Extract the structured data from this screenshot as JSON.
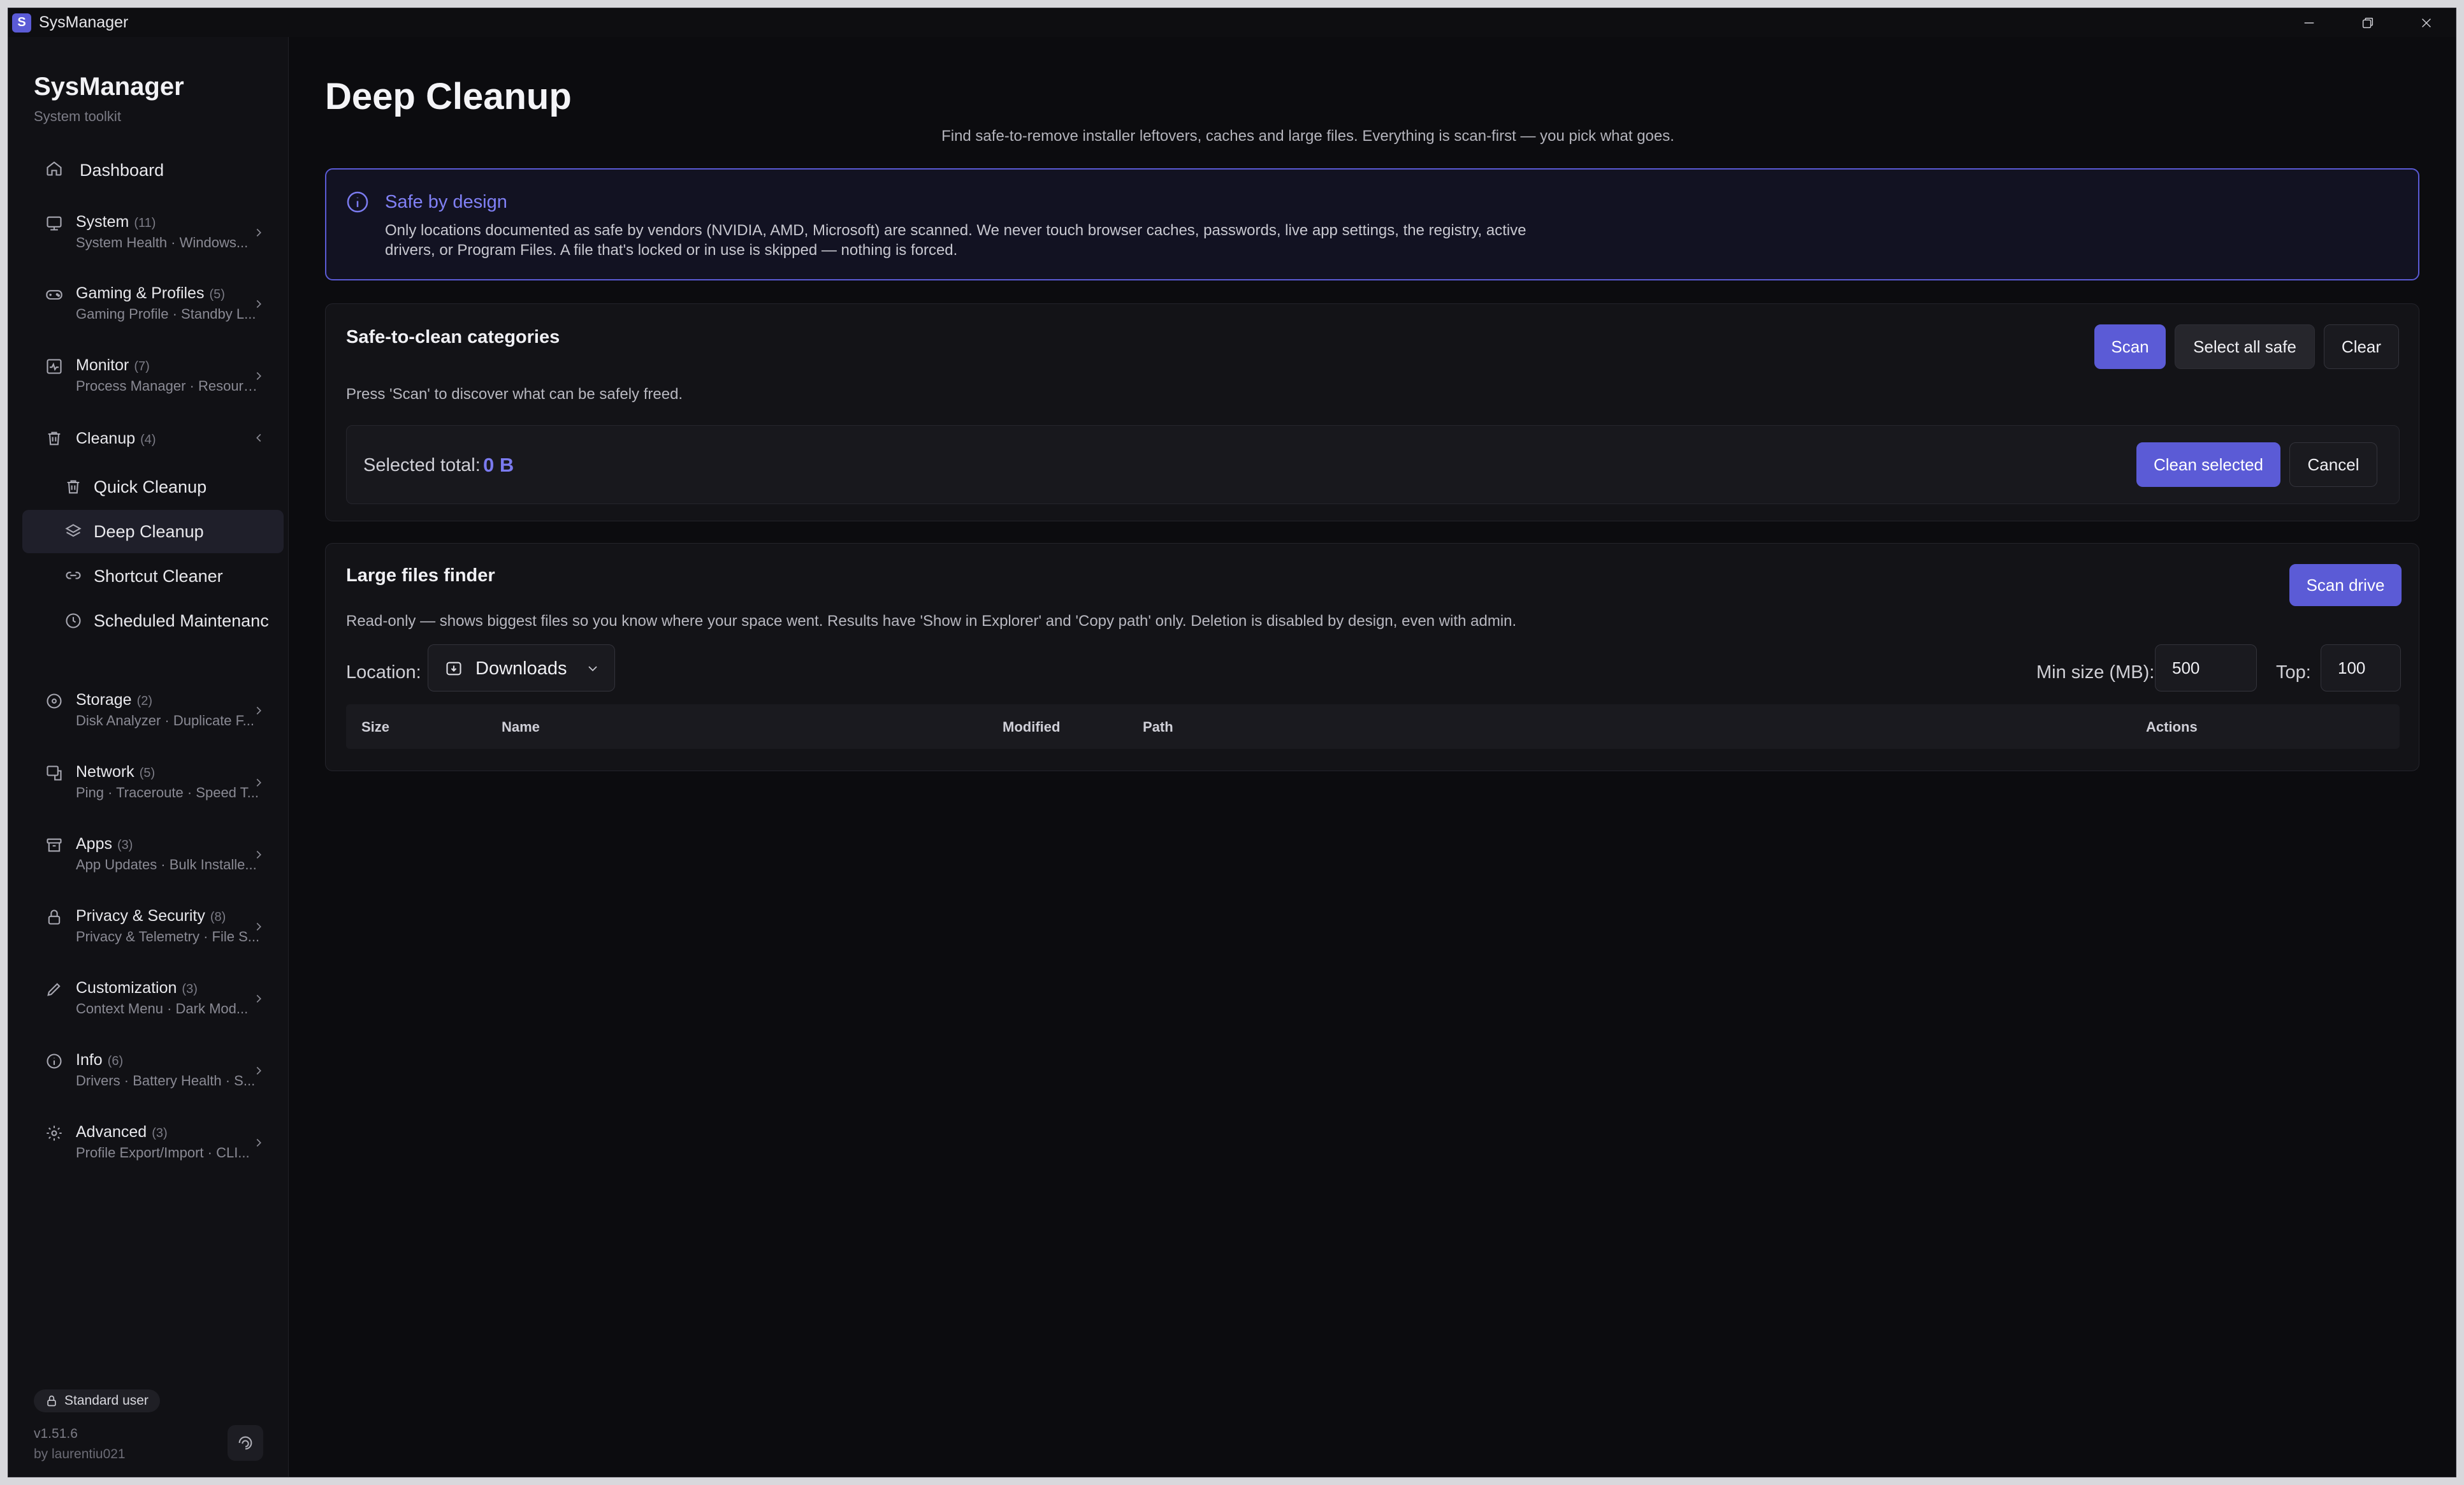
{
  "window": {
    "title": "SysManager",
    "app_icon_letter": "S"
  },
  "sidebar": {
    "brand": "SysManager",
    "brand_sub": "System toolkit",
    "dashboard": "Dashboard",
    "groups": [
      {
        "title": "System",
        "count": "(11)",
        "desc": "System Health · Windows..."
      },
      {
        "title": "Gaming & Profiles",
        "count": "(5)",
        "desc": "Gaming Profile · Standby L..."
      },
      {
        "title": "Monitor",
        "count": "(7)",
        "desc": "Process Manager · Resourc..."
      },
      {
        "title": "Cleanup",
        "count": "(4)",
        "desc": ""
      },
      {
        "title": "Storage",
        "count": "(2)",
        "desc": "Disk Analyzer · Duplicate F..."
      },
      {
        "title": "Network",
        "count": "(5)",
        "desc": "Ping · Traceroute · Speed T..."
      },
      {
        "title": "Apps",
        "count": "(3)",
        "desc": "App Updates · Bulk Installe..."
      },
      {
        "title": "Privacy & Security",
        "count": "(8)",
        "desc": "Privacy & Telemetry · File S..."
      },
      {
        "title": "Customization",
        "count": "(3)",
        "desc": "Context Menu · Dark Mod..."
      },
      {
        "title": "Info",
        "count": "(6)",
        "desc": "Drivers · Battery Health · S..."
      },
      {
        "title": "Advanced",
        "count": "(3)",
        "desc": "Profile Export/Import · CLI..."
      }
    ],
    "cleanup_items": [
      "Quick Cleanup",
      "Deep Cleanup",
      "Shortcut Cleaner",
      "Scheduled Maintenanc"
    ],
    "user_role": "Standard user",
    "version": "v1.51.6",
    "author": "by laurentiu021"
  },
  "main": {
    "title": "Deep Cleanup",
    "description": "Find safe-to-remove installer leftovers, caches and large files. Everything is scan-first — you pick what goes.",
    "info": {
      "title": "Safe by design",
      "text": "Only locations documented as safe by vendors (NVIDIA, AMD, Microsoft) are scanned. We never touch browser caches, passwords, live app settings, the registry, active drivers, or Program Files. A file that's locked or in use is skipped — nothing is forced."
    },
    "categories": {
      "title": "Safe-to-clean categories",
      "scan": "Scan",
      "select_all": "Select all safe",
      "clear": "Clear",
      "hint": "Press 'Scan' to discover what can be safely freed.",
      "selected_label": "Selected total:",
      "selected_value": "0 B",
      "clean_selected": "Clean selected",
      "cancel": "Cancel"
    },
    "large_files": {
      "title": "Large files finder",
      "scan_drive": "Scan drive",
      "description": "Read-only — shows biggest files so you know where your space went. Results have 'Show in Explorer' and 'Copy path' only. Deletion is disabled by design, even with admin.",
      "location_label": "Location:",
      "location_value": "Downloads",
      "min_size_label": "Min size (MB):",
      "min_size_value": "500",
      "top_label": "Top:",
      "top_value": "100",
      "columns": [
        "Size",
        "Name",
        "Modified",
        "Path",
        "Actions"
      ]
    }
  },
  "colors": {
    "accent": "#5b5bd6",
    "accent_text": "#7b7bf0",
    "background": "#0c0c0f",
    "sidebar": "#111115",
    "card": "#131317"
  }
}
